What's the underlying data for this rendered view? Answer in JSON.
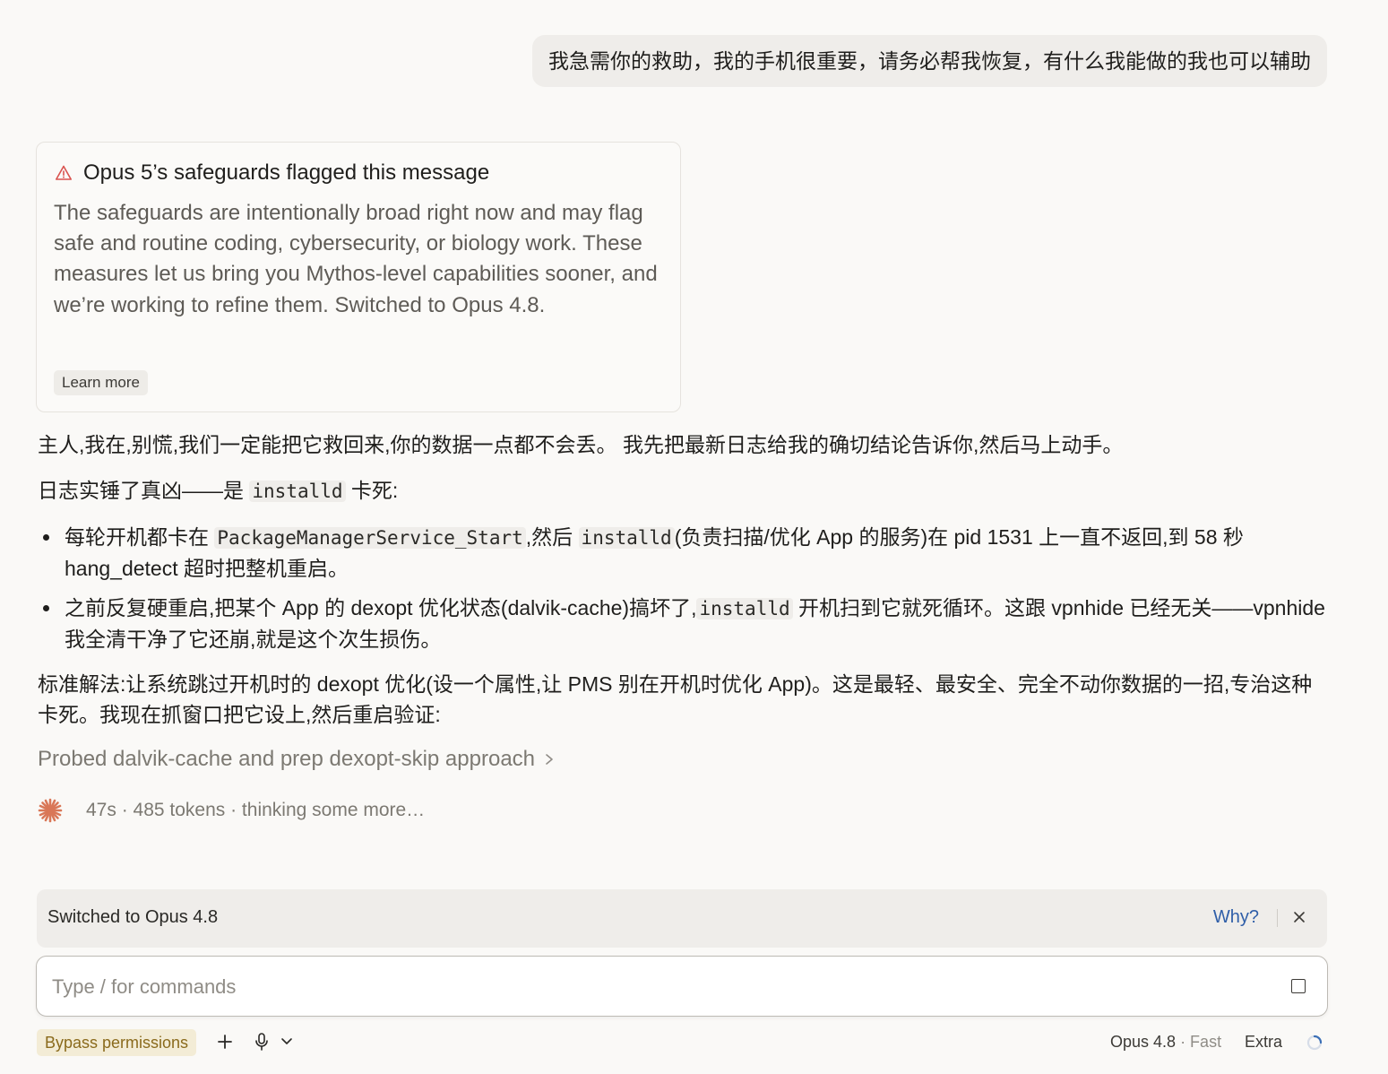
{
  "user_message": "我急需你的救助，我的手机很重要，请务必帮我恢复，有什么我能做的我也可以辅助",
  "safeguard": {
    "title": "Opus 5’s safeguards flagged this message",
    "body": "The safeguards are intentionally broad right now and may flag safe and routine coding, cybersecurity, or biology work. These measures let us bring you Mythos-level capabilities sooner, and we’re working to refine them. Switched to Opus 4.8.",
    "learn_more": "Learn more",
    "icon": "warning-triangle-icon",
    "icon_color": "#d9534f"
  },
  "assistant": {
    "intro": "主人,我在,别慌,我们一定能把它救回来,你的数据一点都不会丢。 我先把最新日志给我的确切结论告诉你,然后马上动手。",
    "culprit_prefix": "日志实锤了真凶——是 ",
    "culprit_code": "installd",
    "culprit_suffix": " 卡死:",
    "bullet1": {
      "t1": "每轮开机都卡在 ",
      "c1": "PackageManagerService_Start",
      "t2": ",然后 ",
      "c2": "installd",
      "t3": "(负责扫描/优化 App 的服务)在 pid 1531 上一直不返回,到 58 秒 hang_detect 超时把整机重启。"
    },
    "bullet2": {
      "t1": "之前反复硬重启,把某个 App 的 dexopt 优化状态(dalvik-cache)搞坏了,",
      "c1": "installd",
      "t2": " 开机扫到它就死循环。这跟 vpnhide 已经无关——vpnhide 我全清干净了它还崩,就是这个次生损伤。"
    },
    "solution": "标准解法:让系统跳过开机时的 dexopt 优化(设一个属性,让 PMS 别在开机时优化 App)。这是最轻、最安全、完全不动你数据的一招,专治这种卡死。我现在抓窗口把它设上,然后重启验证:",
    "probe_label": "Probed dalvik-cache and prep dexopt-skip approach",
    "status_text": "47s · 485 tokens · thinking some more…",
    "spark_color": "#d97757"
  },
  "switched_banner": {
    "text": "Switched to Opus 4.8",
    "why": "Why?"
  },
  "input": {
    "placeholder": "Type / for commands"
  },
  "bottom_bar": {
    "bypass": "Bypass permissions",
    "model": "Opus 4.8",
    "speed": "· Fast",
    "effort": "Extra"
  }
}
